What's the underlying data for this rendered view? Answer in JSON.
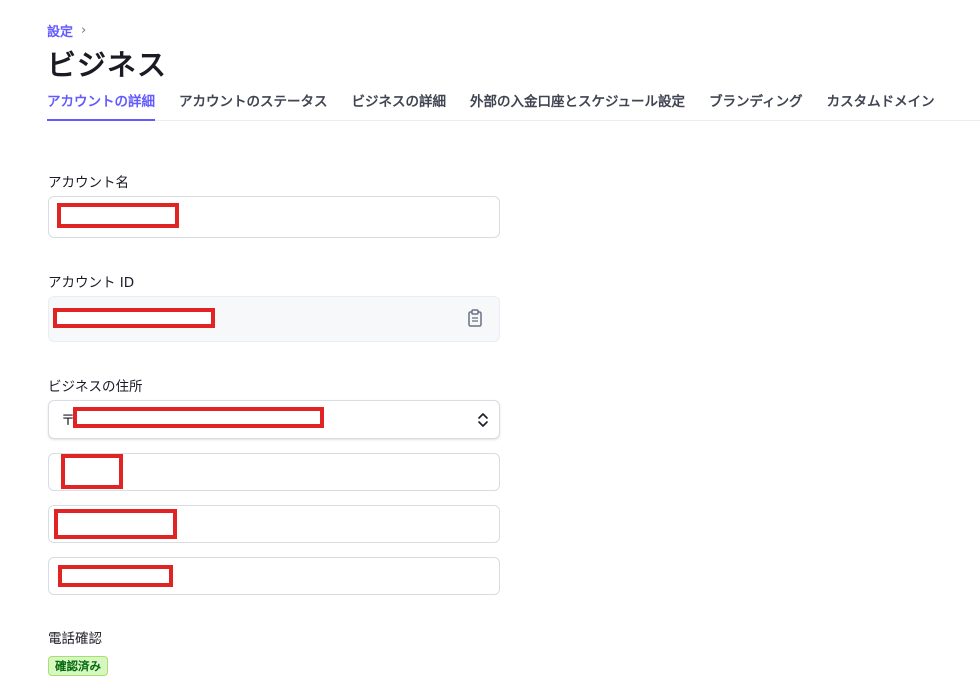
{
  "breadcrumb": {
    "parent": "設定",
    "separator": "›"
  },
  "page": {
    "title": "ビジネス"
  },
  "tabs": [
    {
      "label": "アカウントの詳細",
      "active": true
    },
    {
      "label": "アカウントのステータス",
      "active": false
    },
    {
      "label": "ビジネスの詳細",
      "active": false
    },
    {
      "label": "外部の入金口座とスケジュール設定",
      "active": false
    },
    {
      "label": "ブランディング",
      "active": false
    },
    {
      "label": "カスタムドメイン",
      "active": false
    }
  ],
  "form": {
    "account_name": {
      "label": "アカウント名",
      "value": ""
    },
    "account_id": {
      "label": "アカウント ID",
      "value": ""
    },
    "business_address": {
      "label": "ビジネスの住所",
      "postal_prefix": "〒",
      "line1": "",
      "line2": "",
      "line3": ""
    },
    "phone_verification": {
      "label": "電話確認",
      "status": "確認済み"
    }
  },
  "colors": {
    "accent": "#635bff",
    "redaction": "#e02424",
    "success_bg": "#d7f7c2",
    "success_text": "#05690d"
  },
  "icons": {
    "copy": "clipboard-icon",
    "select": "chevron-up-down-icon",
    "breadcrumb": "chevron-right-icon"
  }
}
